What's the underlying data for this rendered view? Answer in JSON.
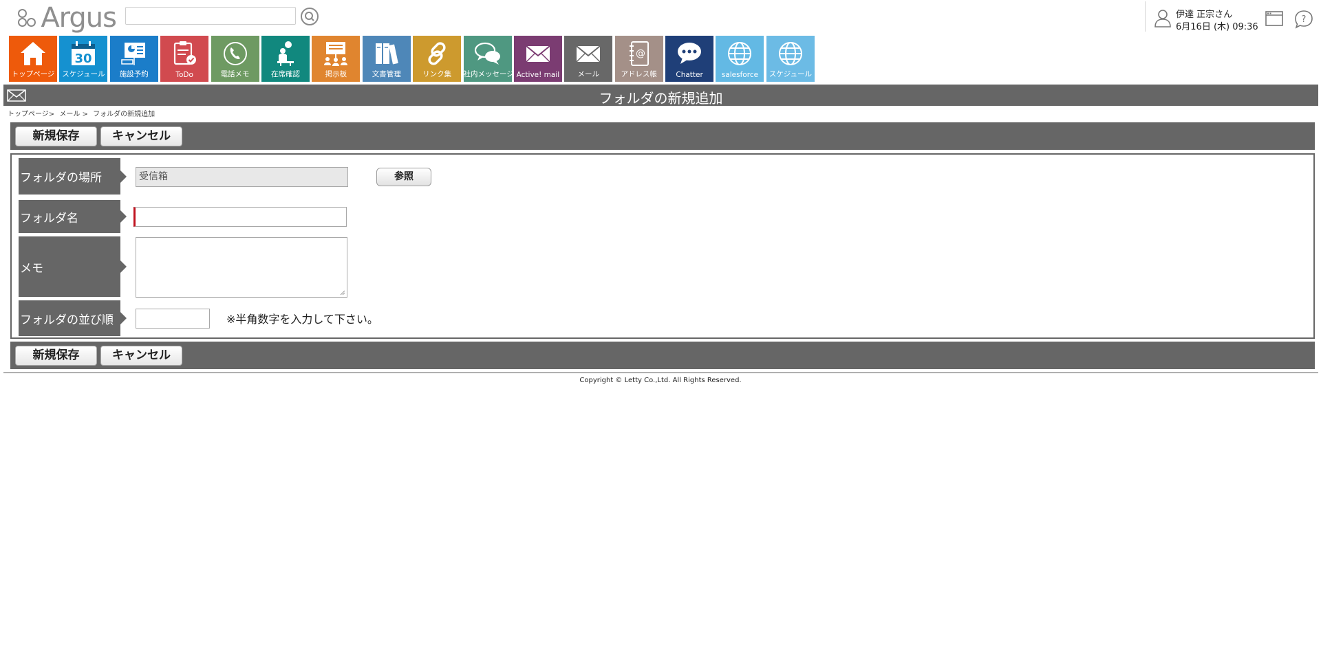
{
  "header": {
    "logo_text": "Argus",
    "search": {
      "value": "",
      "placeholder": ""
    },
    "user": {
      "name": "伊達 正宗さん",
      "datetime": "6月16日 (木) 09:36"
    }
  },
  "tiles": [
    {
      "label": "トップページ",
      "icon": "home-icon",
      "color": "#ee5a0b"
    },
    {
      "label": "スケジュール",
      "icon": "calendar-icon",
      "color": "#1591d0",
      "day": "30"
    },
    {
      "label": "施設予約",
      "icon": "facility-icon",
      "color": "#1b7dc9"
    },
    {
      "label": "ToDo",
      "icon": "todo-icon",
      "color": "#d14a4f"
    },
    {
      "label": "電話メモ",
      "icon": "phone-icon",
      "color": "#6e9a62"
    },
    {
      "label": "在席確認",
      "icon": "presence-icon",
      "color": "#11887e"
    },
    {
      "label": "掲示板",
      "icon": "board-icon",
      "color": "#e0852f"
    },
    {
      "label": "文書管理",
      "icon": "documents-icon",
      "color": "#4e87b8"
    },
    {
      "label": "リンク集",
      "icon": "link-icon",
      "color": "#cd9a2e"
    },
    {
      "label": "社内メッセージ",
      "icon": "message-icon",
      "color": "#4f9881"
    },
    {
      "label": "Active! mail",
      "icon": "mail-icon",
      "color": "#7b3c72"
    },
    {
      "label": "メール",
      "icon": "mail-icon",
      "color": "#686868"
    },
    {
      "label": "アドレス帳",
      "icon": "address-book-icon",
      "color": "#a49088"
    },
    {
      "label": "Chatter",
      "icon": "chatter-icon",
      "color": "#1f3f78"
    },
    {
      "label": "salesforce",
      "icon": "globe-icon",
      "color": "#63b9e4"
    },
    {
      "label": "スケジュール",
      "icon": "globe-icon",
      "color": "#6cbbe5"
    }
  ],
  "page": {
    "title": "フォルダの新規追加",
    "breadcrumb": [
      "トップページ>",
      "メール >",
      "フォルダの新規追加"
    ]
  },
  "actions": {
    "save_label": "新規保存",
    "cancel_label": "キャンセル"
  },
  "form": {
    "location": {
      "label": "フォルダの場所",
      "value": "受信箱",
      "browse_label": "参照"
    },
    "name": {
      "label": "フォルダ名",
      "value": ""
    },
    "memo": {
      "label": "メモ",
      "value": ""
    },
    "order": {
      "label": "フォルダの並び順",
      "value": "",
      "hint": "※半角数字を入力して下さい。"
    }
  },
  "footer": {
    "copyright": "Copyright © Letty Co.,Ltd. All Rights Reserved."
  }
}
